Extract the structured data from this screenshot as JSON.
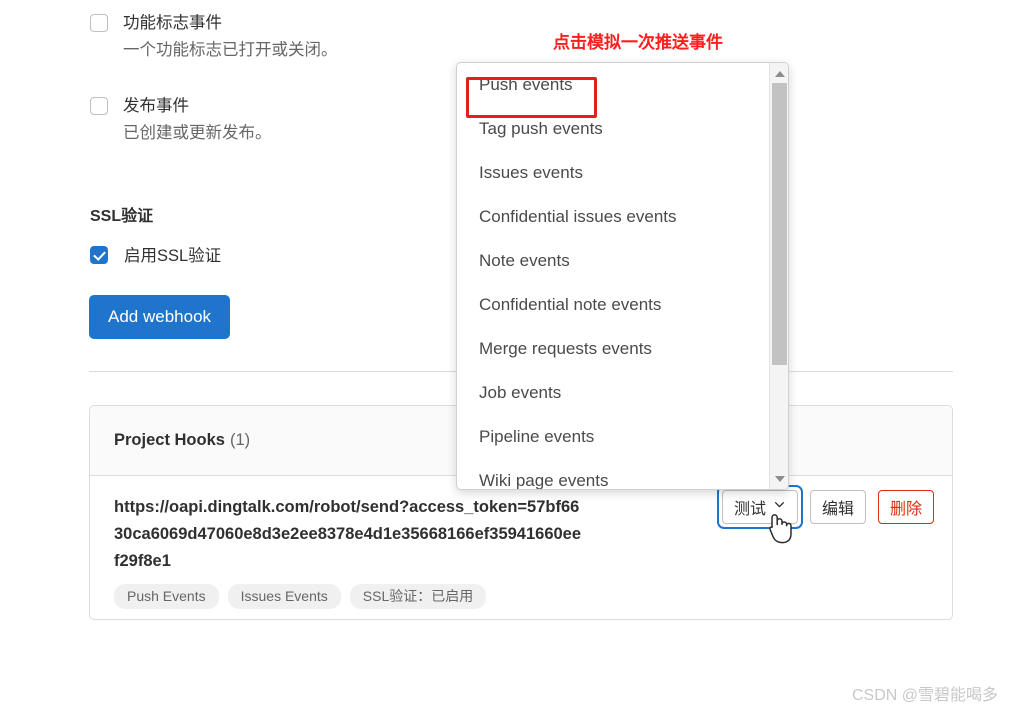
{
  "events": [
    {
      "title": "功能标志事件",
      "description": "一个功能标志已打开或关闭。",
      "checked": false
    },
    {
      "title": "发布事件",
      "description": "已创建或更新发布。",
      "checked": false
    }
  ],
  "ssl": {
    "section_title": "SSL验证",
    "checkbox_label": "启用SSL验证",
    "checked": true
  },
  "add_webhook_button": "Add webhook",
  "hooks_card": {
    "header_title": "Project Hooks",
    "header_count": "(1)",
    "url": "https://oapi.dingtalk.com/robot/send?access_token=57bf6630ca6069d47060e8d3e2ee8378e4d1e35668166ef35941660eef29f8e1",
    "pills": [
      "Push Events",
      "Issues Events",
      "SSL验证：已启用"
    ],
    "actions": {
      "test_label": "测试",
      "edit_label": "编辑",
      "delete_label": "删除"
    }
  },
  "dropdown": {
    "items": [
      "Push events",
      "Tag push events",
      "Issues events",
      "Confidential issues events",
      "Note events",
      "Confidential note events",
      "Merge requests events",
      "Job events",
      "Pipeline events",
      "Wiki page events"
    ],
    "scroll_up_icon": "triangle-up-icon",
    "scroll_down_icon": "triangle-down-icon"
  },
  "annotation": {
    "text": "点击模拟一次推送事件",
    "color": "#ff1e1e"
  },
  "watermark": "CSDN @雪碧能喝多",
  "colors": {
    "primary_blue": "#1f75cb",
    "danger_red": "#dd2b0e",
    "annotation_red": "#e01f1f",
    "text": "#303030",
    "muted": "#666666"
  }
}
